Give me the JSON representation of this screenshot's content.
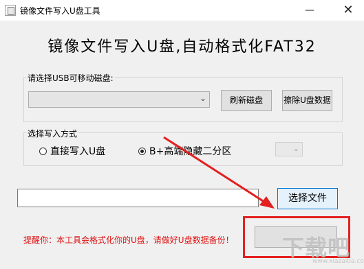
{
  "window": {
    "title": "镜像文件写入U盘工具",
    "minimize_glyph": "—",
    "close_glyph": "✕"
  },
  "heading": "镜像文件写入U盘,自动格式化FAT32",
  "usb_group": {
    "title": "请选择USB可移动磁盘:",
    "combo_value": "",
    "refresh_label": "刷新磁盘",
    "erase_label": "擦除U盘数据"
  },
  "mode_group": {
    "title": "选择写入方式",
    "options": [
      {
        "label": "直接写入U盘",
        "selected": false
      },
      {
        "label": "B+高端隐藏二分区",
        "selected": true
      }
    ],
    "small_combo_value": ""
  },
  "file": {
    "path_value": "",
    "select_label": "选择文件"
  },
  "write_button": {
    "label": ""
  },
  "warning": "提醒你：本工具会格式化你的U盘，请做好U盘数据备份！",
  "watermark": {
    "text": "下载吧",
    "url": "www.xiazaiba.com"
  },
  "colors": {
    "accent_red": "#e42020",
    "warning_red": "#e01010",
    "select_border": "#0078d7"
  }
}
